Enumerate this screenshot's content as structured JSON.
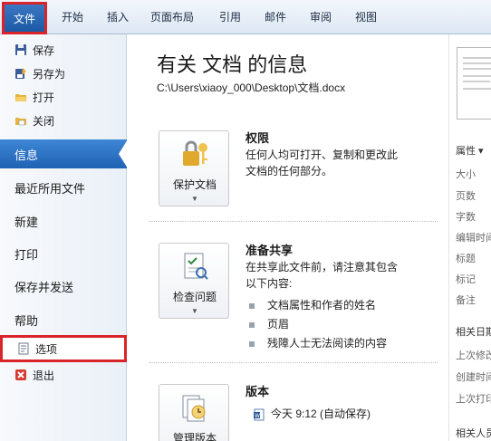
{
  "ribbon": {
    "file_tab": "文件",
    "tabs": [
      "开始",
      "插入",
      "页面布局",
      "引用",
      "邮件",
      "审阅",
      "视图"
    ]
  },
  "menu": {
    "commands": [
      "保存",
      "另存为",
      "打开",
      "关闭"
    ],
    "sections": [
      "信息",
      "最近所用文件",
      "新建",
      "打印",
      "保存并发送",
      "帮助"
    ],
    "options": "选项",
    "exit": "退出"
  },
  "info": {
    "title": "有关 文档 的信息",
    "path": "C:\\Users\\xiaoy_000\\Desktop\\文档.docx",
    "permissions": {
      "button": "保护文档",
      "heading": "权限",
      "description": "任何人均可打开、复制和更改此文档的任何部分。"
    },
    "prepare": {
      "button": "检查问题",
      "heading": "准备共享",
      "description": "在共享此文件前，请注意其包含以下内容:",
      "items": [
        "文档属性和作者的姓名",
        "页眉",
        "残障人士无法阅读的内容"
      ]
    },
    "versions": {
      "button": "管理版本",
      "heading": "版本",
      "entry": "今天 9:12 (自动保存)"
    }
  },
  "properties": {
    "header": "属性 ▾",
    "fields": [
      "大小",
      "页数",
      "字数",
      "编辑时间",
      "标题",
      "标记",
      "备注"
    ],
    "related_dates_header": "相关日期",
    "dates": [
      "上次修改",
      "创建时间",
      "上次打印"
    ],
    "related_people_header": "相关人员"
  },
  "colors": {
    "file_tab": "#1d5aa6",
    "active_section": "#2f74c6",
    "highlight_border": "#d9242a"
  }
}
